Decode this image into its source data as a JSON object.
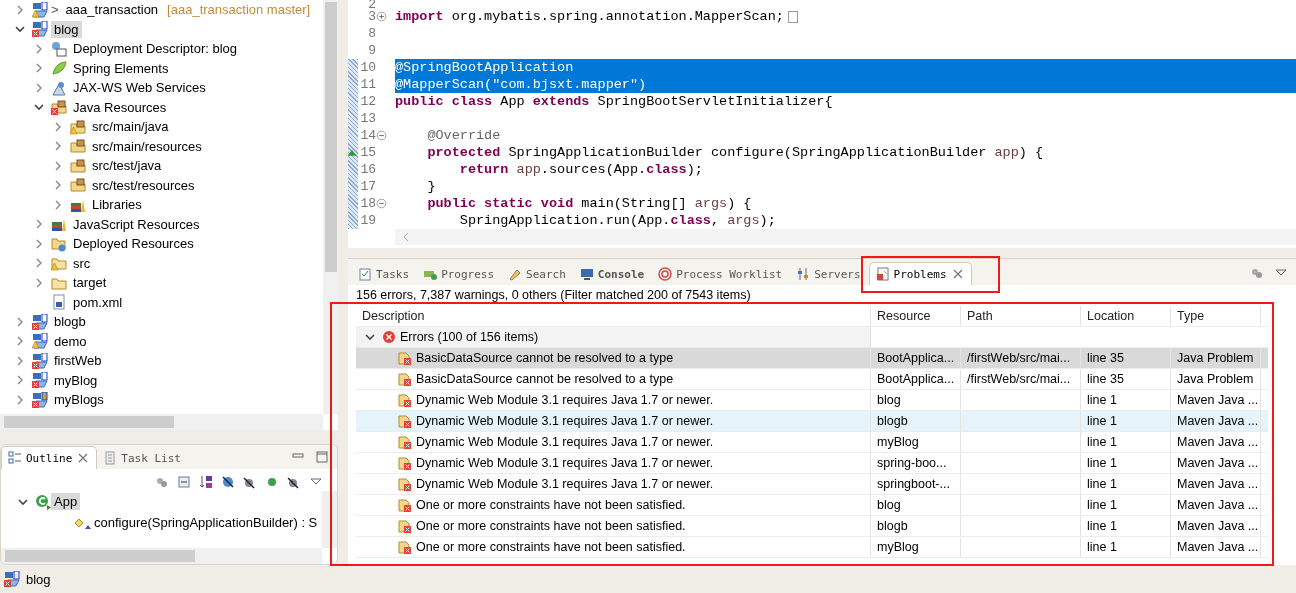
{
  "explorer": {
    "items": [
      {
        "label": "aaa_transaction",
        "prefix": ">",
        "suffix": "[aaa_transaction master]",
        "kind": "project",
        "error": false,
        "warning": true,
        "expanded": false,
        "selected": false
      },
      {
        "label": "blog",
        "kind": "project",
        "error": true,
        "warning": false,
        "expanded": true,
        "selected": true,
        "children": [
          {
            "label": "Deployment Descriptor: blog",
            "kind": "descriptor",
            "error": false,
            "warning": false,
            "expanded": false,
            "selected": false
          },
          {
            "label": "Spring Elements",
            "kind": "spring",
            "error": false,
            "warning": false,
            "expanded": false,
            "selected": false
          },
          {
            "label": "JAX-WS Web Services",
            "kind": "webservice",
            "error": false,
            "warning": false,
            "expanded": false,
            "selected": false
          },
          {
            "label": "Java Resources",
            "kind": "resources",
            "error": true,
            "warning": false,
            "expanded": true,
            "selected": false,
            "children": [
              {
                "label": "src/main/java",
                "kind": "source-folder",
                "error": false,
                "warning": true,
                "expanded": false,
                "selected": false
              },
              {
                "label": "src/main/resources",
                "kind": "source-folder",
                "error": false,
                "warning": false,
                "expanded": false,
                "selected": false
              },
              {
                "label": "src/test/java",
                "kind": "source-folder",
                "error": false,
                "warning": false,
                "expanded": false,
                "selected": false
              },
              {
                "label": "src/test/resources",
                "kind": "source-folder",
                "error": false,
                "warning": false,
                "expanded": false,
                "selected": false
              },
              {
                "label": "Libraries",
                "kind": "library",
                "error": false,
                "warning": false,
                "expanded": false,
                "selected": false
              }
            ]
          },
          {
            "label": "JavaScript Resources",
            "kind": "library",
            "error": false,
            "warning": false,
            "expanded": false,
            "selected": false
          },
          {
            "label": "Deployed Resources",
            "kind": "deployed",
            "error": false,
            "warning": false,
            "expanded": false,
            "selected": false
          },
          {
            "label": "src",
            "kind": "folder",
            "error": false,
            "warning": true,
            "expanded": false,
            "selected": false
          },
          {
            "label": "target",
            "kind": "folder",
            "error": false,
            "warning": false,
            "expanded": false,
            "selected": false
          },
          {
            "label": "pom.xml",
            "kind": "xml-file",
            "error": false,
            "warning": false,
            "selected": false
          }
        ]
      },
      {
        "label": "blogb",
        "kind": "project",
        "error": true,
        "warning": false,
        "expanded": false,
        "selected": false
      },
      {
        "label": "demo",
        "kind": "project",
        "error": false,
        "warning": true,
        "expanded": false,
        "selected": false
      },
      {
        "label": "firstWeb",
        "kind": "project",
        "error": true,
        "warning": false,
        "expanded": false,
        "selected": false
      },
      {
        "label": "myBlog",
        "kind": "project",
        "error": true,
        "warning": false,
        "expanded": false,
        "selected": false
      },
      {
        "label": "myBlogs",
        "kind": "java-project",
        "error": true,
        "warning": false,
        "expanded": false,
        "selected": false
      }
    ]
  },
  "outline": {
    "tabs": [
      {
        "label": "Outline",
        "selected": true,
        "closable": true
      },
      {
        "label": "Task List",
        "selected": false,
        "closable": false
      }
    ],
    "tree": [
      {
        "label": "App",
        "kind": "class",
        "selected": true,
        "expanded": true,
        "children": [
          {
            "label": "configure(SpringApplicationBuilder) : S",
            "kind": "method",
            "selected": false
          }
        ]
      }
    ]
  },
  "editor": {
    "lines": [
      {
        "number": "2",
        "selected": false
      },
      {
        "number": "3",
        "collapsed": true,
        "selected": false,
        "segments": [
          {
            "text": "import",
            "kind": "keyword"
          },
          {
            "text": " org.mybatis.spring.annotation.MapperScan;",
            "kind": "plain"
          }
        ]
      },
      {
        "number": "8",
        "selected": false
      },
      {
        "number": "9",
        "selected": false
      },
      {
        "number": "10",
        "selected": true,
        "segments": [
          {
            "text": "@SpringBootApplication",
            "kind": "annotation"
          }
        ]
      },
      {
        "number": "11",
        "selected": true,
        "segments": [
          {
            "text": "@MapperScan(",
            "kind": "annotation"
          },
          {
            "text": "\"com.bjsxt.mapper\"",
            "kind": "string"
          },
          {
            "text": ")",
            "kind": "annotation"
          }
        ]
      },
      {
        "number": "12",
        "selected": false,
        "segments": [
          {
            "text": "public class",
            "kind": "keyword"
          },
          {
            "text": " App ",
            "kind": "plain"
          },
          {
            "text": "extends",
            "kind": "keyword"
          },
          {
            "text": " SpringBootServletInitializer{",
            "kind": "plain"
          }
        ]
      },
      {
        "number": "13",
        "selected": false
      },
      {
        "number": "14",
        "collapsed": false,
        "selected": false,
        "segments": [
          {
            "text": "    @Override",
            "kind": "annotation"
          }
        ]
      },
      {
        "number": "15",
        "override": true,
        "selected": false,
        "segments": [
          {
            "text": "    protected",
            "kind": "keyword"
          },
          {
            "text": " SpringApplicationBuilder configure(SpringApplicationBuilder ",
            "kind": "plain"
          },
          {
            "text": "app",
            "kind": "variable"
          },
          {
            "text": ") {",
            "kind": "plain"
          }
        ]
      },
      {
        "number": "16",
        "selected": false,
        "segments": [
          {
            "text": "        return ",
            "kind": "keyword"
          },
          {
            "text": "app",
            "kind": "variable"
          },
          {
            "text": ".sources(App.",
            "kind": "plain"
          },
          {
            "text": "class",
            "kind": "keyword"
          },
          {
            "text": ");",
            "kind": "plain"
          }
        ]
      },
      {
        "number": "17",
        "selected": false,
        "segments": [
          {
            "text": "    }",
            "kind": "plain"
          }
        ]
      },
      {
        "number": "18",
        "collapsed": false,
        "selected": false,
        "segments": [
          {
            "text": "    public static void",
            "kind": "keyword"
          },
          {
            "text": " main(String[] ",
            "kind": "plain"
          },
          {
            "text": "args",
            "kind": "variable"
          },
          {
            "text": ") {",
            "kind": "plain"
          }
        ]
      },
      {
        "number": "19",
        "selected": false,
        "segments": [
          {
            "text": "        SpringApplication.run(App.",
            "kind": "plain"
          },
          {
            "text": "class",
            "kind": "keyword"
          },
          {
            "text": ", ",
            "kind": "plain"
          },
          {
            "text": "args",
            "kind": "variable"
          },
          {
            "text": ");",
            "kind": "plain"
          }
        ]
      }
    ]
  },
  "problems_view": {
    "tabs": [
      {
        "label": "Tasks",
        "kind": "tasks",
        "selected": false,
        "bold": false,
        "closable": false,
        "highlighted": false
      },
      {
        "label": "Progress",
        "kind": "progress",
        "selected": false,
        "bold": false,
        "closable": false,
        "highlighted": false
      },
      {
        "label": "Search",
        "kind": "search",
        "selected": false,
        "bold": false,
        "closable": false,
        "highlighted": false
      },
      {
        "label": "Console",
        "kind": "console",
        "selected": false,
        "bold": true,
        "closable": false,
        "highlighted": false
      },
      {
        "label": "Process Worklist",
        "kind": "worklist",
        "selected": false,
        "bold": false,
        "closable": false,
        "highlighted": false
      },
      {
        "label": "Servers",
        "kind": "servers",
        "selected": false,
        "bold": false,
        "closable": false,
        "highlighted": false
      },
      {
        "label": "Problems",
        "kind": "problems",
        "selected": true,
        "bold": false,
        "closable": true,
        "highlighted": true
      }
    ],
    "summary": "156 errors, 7,387 warnings, 0 others (Filter matched 200 of 7543 items)",
    "table": {
      "highlighted": true,
      "columns": [
        "Description",
        "Resource",
        "Path",
        "Location",
        "Type"
      ],
      "group": {
        "label": "Errors (100 of 156 items)",
        "expanded": true
      },
      "rows": [
        {
          "description": "BasicDataSource cannot be resolved to a type",
          "resource": "BootApplica...",
          "path": "/firstWeb/src/mai...",
          "location": "line 35",
          "type": "Java Problem",
          "selected": true,
          "hovered": false
        },
        {
          "description": "BasicDataSource cannot be resolved to a type",
          "resource": "BootApplica...",
          "path": "/firstWeb/src/mai...",
          "location": "line 35",
          "type": "Java Problem",
          "selected": false,
          "hovered": false
        },
        {
          "description": "Dynamic Web Module 3.1 requires Java 1.7 or newer.",
          "resource": "blog",
          "location": "line 1",
          "type": "Maven Java ...",
          "selected": false,
          "hovered": false
        },
        {
          "description": "Dynamic Web Module 3.1 requires Java 1.7 or newer.",
          "resource": "blogb",
          "location": "line 1",
          "type": "Maven Java ...",
          "selected": false,
          "hovered": true
        },
        {
          "description": "Dynamic Web Module 3.1 requires Java 1.7 or newer.",
          "resource": "myBlog",
          "location": "line 1",
          "type": "Maven Java ...",
          "selected": false,
          "hovered": false
        },
        {
          "description": "Dynamic Web Module 3.1 requires Java 1.7 or newer.",
          "resource": "spring-boo...",
          "location": "line 1",
          "type": "Maven Java ...",
          "selected": false,
          "hovered": false
        },
        {
          "description": "Dynamic Web Module 3.1 requires Java 1.7 or newer.",
          "resource": "springboot-...",
          "location": "line 1",
          "type": "Maven Java ...",
          "selected": false,
          "hovered": false
        },
        {
          "description": "One or more constraints have not been satisfied.",
          "resource": "blog",
          "location": "line 1",
          "type": "Maven Java ...",
          "selected": false,
          "hovered": false
        },
        {
          "description": "One or more constraints have not been satisfied.",
          "resource": "blogb",
          "location": "line 1",
          "type": "Maven Java ...",
          "selected": false,
          "hovered": false
        },
        {
          "description": "One or more constraints have not been satisfied.",
          "resource": "myBlog",
          "location": "line 1",
          "type": "Maven Java ...",
          "selected": false,
          "hovered": false
        }
      ]
    }
  },
  "status_bar": {
    "label": "blog"
  }
}
